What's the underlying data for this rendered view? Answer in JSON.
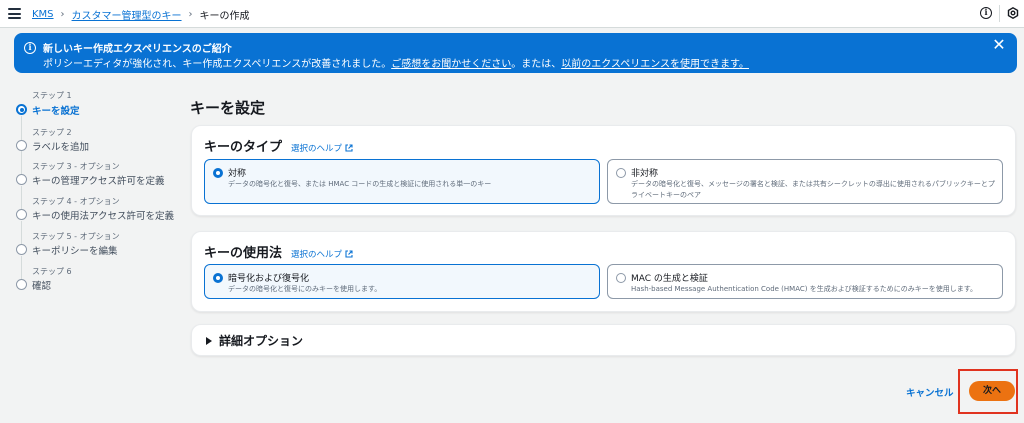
{
  "topbar": {
    "menu_icon": "hamburger-icon",
    "breadcrumb": {
      "root": "KMS",
      "section": "カスタマー管理型のキー",
      "current": "キーの作成"
    },
    "info_icon": "info-icon",
    "settings_icon": "settings-icon"
  },
  "flash": {
    "icon": "info-icon",
    "title": "新しいキー作成エクスペリエンスのご紹介",
    "body_prefix": "ポリシーエディタが強化され、キー作成エクスペリエンスが改善されました。",
    "feedback_link": "ご感想をお聞かせください",
    "body_middle": "。または、",
    "previous_link": "以前のエクスペリエンスを使用できます。",
    "color": "#0972d3"
  },
  "steps": [
    {
      "sub": "ステップ 1",
      "label": "キーを設定",
      "active": true
    },
    {
      "sub": "ステップ 2",
      "label": "ラベルを追加",
      "active": false
    },
    {
      "sub": "ステップ 3 - オプション",
      "label": "キーの管理アクセス許可を定義",
      "active": false
    },
    {
      "sub": "ステップ 4 - オプション",
      "label": "キーの使用法アクセス許可を定義",
      "active": false
    },
    {
      "sub": "ステップ 5 - オプション",
      "label": "キーポリシーを編集",
      "active": false
    },
    {
      "sub": "ステップ 6",
      "label": "確認",
      "active": false
    }
  ],
  "main": {
    "title": "キーを設定",
    "key_type": {
      "title": "キーのタイプ",
      "help": "選択のヘルプ",
      "options": [
        {
          "label": "対称",
          "desc": "データの暗号化と復号、または HMAC コードの生成と検証に使用される単一のキー",
          "selected": true
        },
        {
          "label": "非対称",
          "desc": "データの暗号化と復号、メッセージの署名と検証、または共有シークレットの導出に使用されるパブリックキーとプライベートキーのペア",
          "selected": false
        }
      ]
    },
    "key_usage": {
      "title": "キーの使用法",
      "help": "選択のヘルプ",
      "options": [
        {
          "label": "暗号化および復号化",
          "desc": "データの暗号化と復号にのみキーを使用します。",
          "selected": true
        },
        {
          "label": "MAC の生成と検証",
          "desc": "Hash-based Message Authentication Code (HMAC) を生成および検証するためにのみキーを使用します。",
          "selected": false
        }
      ]
    },
    "advanced": {
      "title": "詳細オプション"
    }
  },
  "footer": {
    "cancel": "キャンセル",
    "next": "次へ",
    "next_color": "#ec7211",
    "highlight_color": "#e0331f"
  }
}
